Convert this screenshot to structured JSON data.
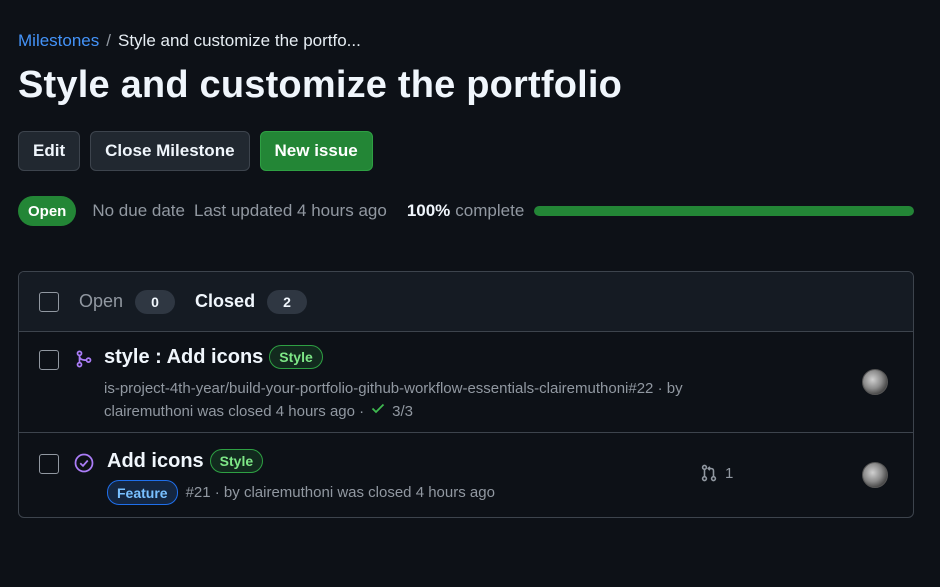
{
  "breadcrumb": {
    "parent": "Milestones",
    "separator": "/",
    "current": "Style and customize the portfo..."
  },
  "title": "Style and customize the portfolio",
  "actions": {
    "edit": "Edit",
    "close_milestone": "Close Milestone",
    "new_issue": "New issue"
  },
  "status": {
    "state": "Open",
    "due": "No due date",
    "updated": "Last updated 4 hours ago",
    "percent": "100%",
    "percent_value": 1.0,
    "complete_label": "complete"
  },
  "tabs": {
    "open_label": "Open",
    "open_count": "0",
    "closed_label": "Closed",
    "closed_count": "2"
  },
  "items": [
    {
      "title": "style : Add icons",
      "label": "Style",
      "meta_line1": "is-project-4th-year/build-your-portfolio-github-workflow-essentials-clairemuthoni#22 · by",
      "meta_line2_prefix": "clairemuthoni was closed 4 hours ago ·",
      "checks": "3/3",
      "type_icon": "git-merge-icon"
    },
    {
      "title": "Add icons",
      "label": "Style",
      "extra_label": "Feature",
      "meta": "#21 · by clairemuthoni was closed 4 hours ago",
      "linked_prs": "1",
      "type_icon": "issue-closed-icon"
    }
  ],
  "colors": {
    "background": "#0d1117",
    "accent_green": "#238636",
    "link_blue": "#4493f8",
    "done_purple": "#ab7df8"
  }
}
